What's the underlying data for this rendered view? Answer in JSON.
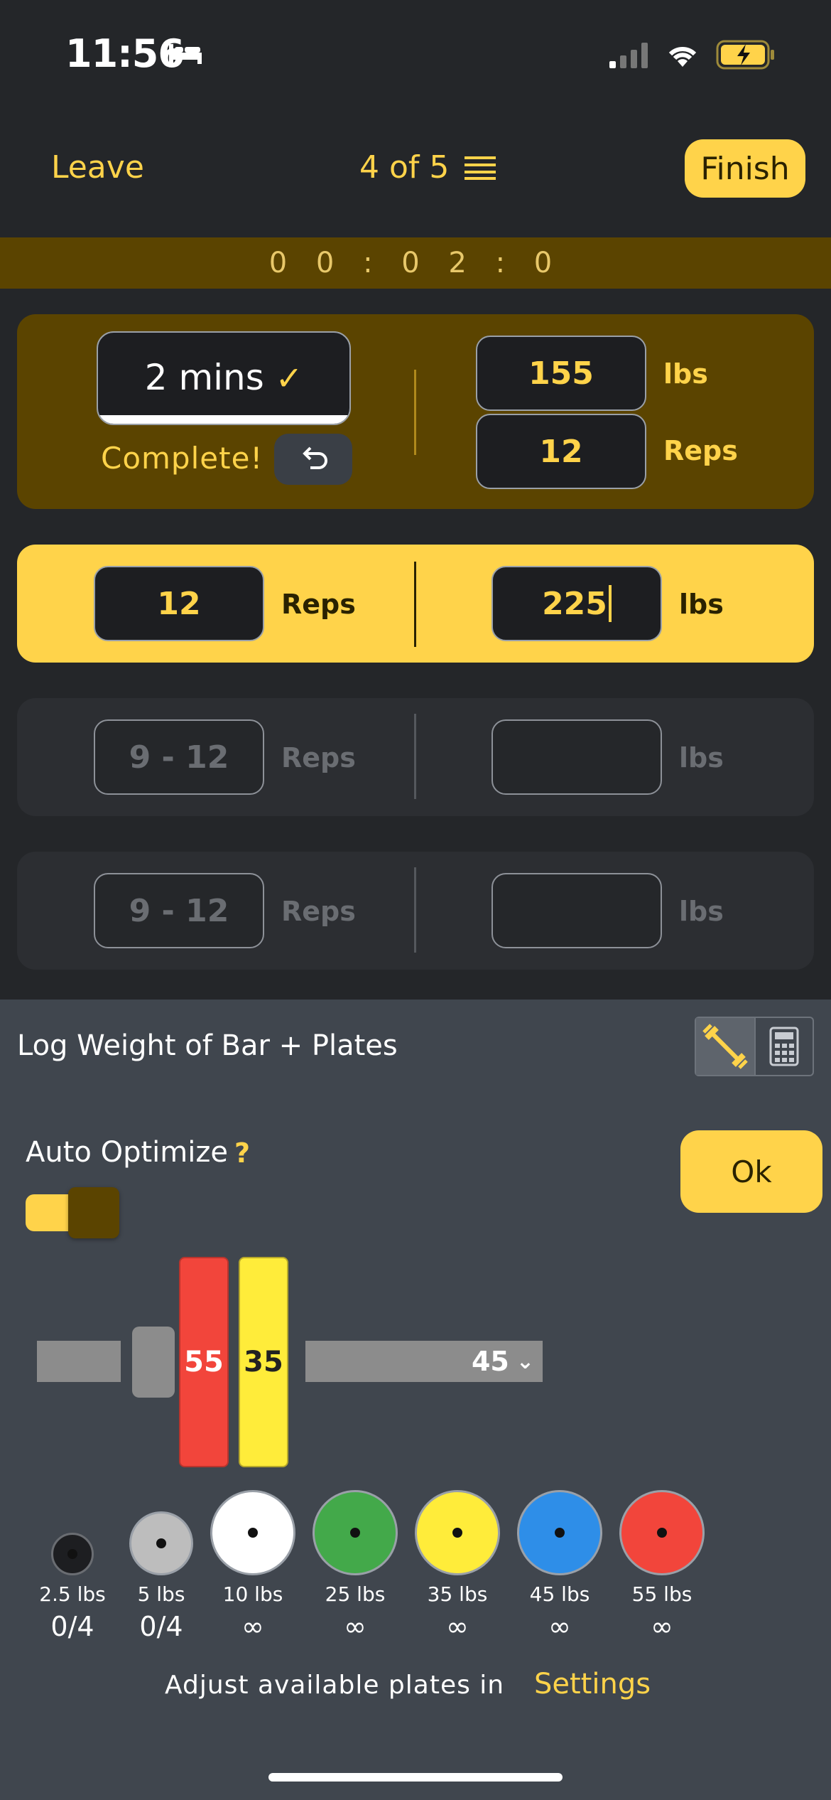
{
  "status_bar": {
    "time": "11:56"
  },
  "nav": {
    "leave": "Leave",
    "progress": "4 of 5",
    "finish": "Finish"
  },
  "timer": "0 0 : 0 2 : 0",
  "sets": [
    {
      "state": "complete",
      "rest": "2 mins",
      "complete_label": "Complete!",
      "weight": "155",
      "weight_unit": "lbs",
      "reps": "12",
      "reps_unit": "Reps"
    },
    {
      "state": "active",
      "reps": "12",
      "reps_unit": "Reps",
      "weight": "225",
      "weight_unit": "lbs"
    },
    {
      "state": "upcoming",
      "reps_placeholder": "9 - 12",
      "reps_unit": "Reps",
      "weight": "",
      "weight_unit": "lbs"
    },
    {
      "state": "upcoming",
      "reps_placeholder": "9 - 12",
      "reps_unit": "Reps",
      "weight": "",
      "weight_unit": "lbs"
    }
  ],
  "panel": {
    "title": "Log Weight of Bar + Plates",
    "auto_optimize": "Auto Optimize",
    "help": "?",
    "ok": "Ok",
    "bar_weight": "45",
    "loaded_plates": [
      "55",
      "35"
    ],
    "plates": [
      {
        "weight": "2.5 lbs",
        "count": "0/4",
        "color": "#1d1e21"
      },
      {
        "weight": "5 lbs",
        "count": "0/4",
        "color": "#bdbdbd"
      },
      {
        "weight": "10 lbs",
        "count": "∞",
        "color": "#ffffff"
      },
      {
        "weight": "25 lbs",
        "count": "∞",
        "color": "#43a94a"
      },
      {
        "weight": "35 lbs",
        "count": "∞",
        "color": "#ffec3a"
      },
      {
        "weight": "45 lbs",
        "count": "∞",
        "color": "#2e8ee8"
      },
      {
        "weight": "55 lbs",
        "count": "∞",
        "color": "#f2453b"
      }
    ],
    "footer_text": "Adjust available plates in",
    "settings_link": "Settings"
  },
  "colors": {
    "accent": "#ffd34a",
    "dark_accent": "#5b4400",
    "background": "#242629",
    "panel": "#40464e"
  }
}
